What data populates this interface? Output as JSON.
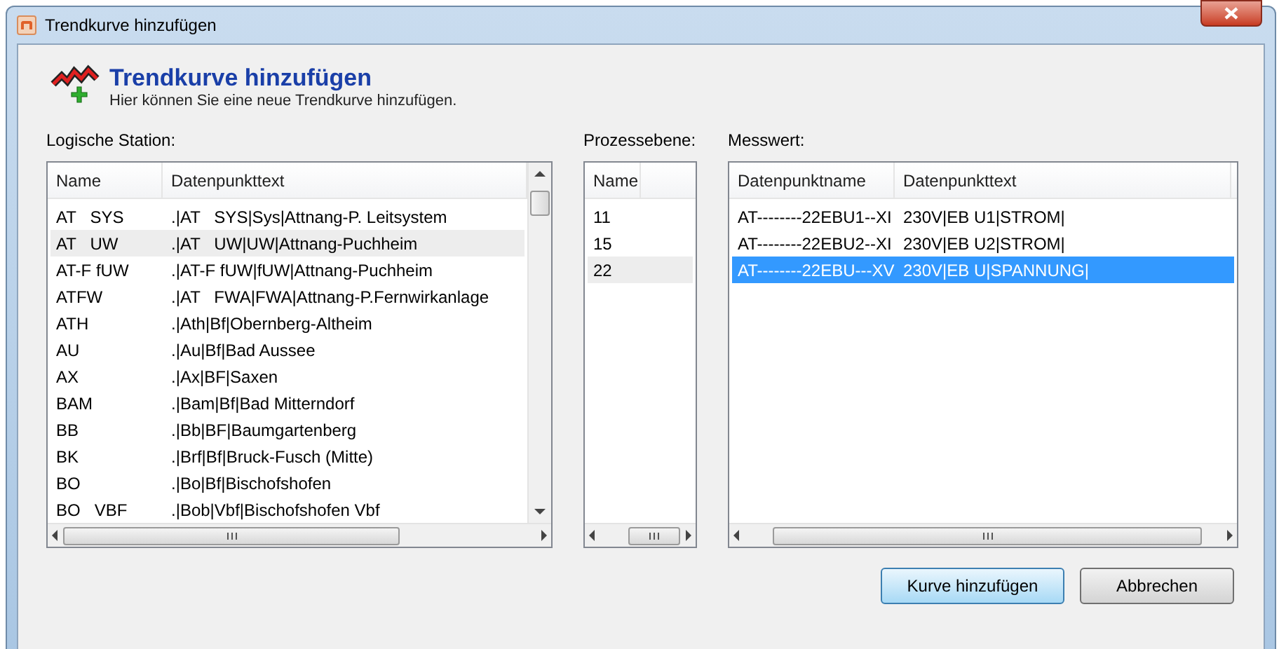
{
  "window": {
    "title": "Trendkurve hinzufügen"
  },
  "header": {
    "title": "Trendkurve hinzufügen",
    "subtitle": "Hier können Sie eine neue Trendkurve hinzufügen."
  },
  "station": {
    "label": "Logische Station:",
    "columns": [
      "Name",
      "Datenpunkttext"
    ],
    "rows": [
      {
        "cells": [
          "AT   SYS",
          ".|AT   SYS|Sys|Attnang-P. Leitsystem"
        ],
        "selected": false
      },
      {
        "cells": [
          "AT   UW",
          ".|AT   UW|UW|Attnang-Puchheim"
        ],
        "selected": true
      },
      {
        "cells": [
          "AT-F fUW",
          ".|AT-F fUW|fUW|Attnang-Puchheim"
        ],
        "selected": false
      },
      {
        "cells": [
          "ATFW",
          ".|AT   FWA|FWA|Attnang-P.Fernwirkanlage"
        ],
        "selected": false
      },
      {
        "cells": [
          "ATH",
          ".|Ath|Bf|Obernberg-Altheim"
        ],
        "selected": false
      },
      {
        "cells": [
          "AU",
          ".|Au|Bf|Bad Aussee"
        ],
        "selected": false
      },
      {
        "cells": [
          "AX",
          ".|Ax|BF|Saxen"
        ],
        "selected": false
      },
      {
        "cells": [
          "BAM",
          ".|Bam|Bf|Bad Mitterndorf"
        ],
        "selected": false
      },
      {
        "cells": [
          "BB",
          ".|Bb|BF|Baumgartenberg"
        ],
        "selected": false
      },
      {
        "cells": [
          "BK",
          ".|Brf|Bf|Bruck-Fusch (Mitte)"
        ],
        "selected": false
      },
      {
        "cells": [
          "BO",
          ".|Bo|Bf|Bischofshofen"
        ],
        "selected": false
      },
      {
        "cells": [
          "BO   VBF",
          ".|Bob|Vbf|Bischofshofen Vbf"
        ],
        "selected": false
      }
    ]
  },
  "process": {
    "label": "Prozessebene:",
    "columns": [
      "Name"
    ],
    "rows": [
      {
        "cells": [
          "11"
        ],
        "selected": false
      },
      {
        "cells": [
          "15"
        ],
        "selected": false
      },
      {
        "cells": [
          "22"
        ],
        "selected": true
      }
    ]
  },
  "measure": {
    "label": "Messwert:",
    "columns": [
      "Datenpunktname",
      "Datenpunkttext"
    ],
    "rows": [
      {
        "cells": [
          "AT--------22EBU1--XI",
          "230V|EB U1|STROM|"
        ],
        "selected": false
      },
      {
        "cells": [
          "AT--------22EBU2--XI",
          "230V|EB U2|STROM|"
        ],
        "selected": false
      },
      {
        "cells": [
          "AT--------22EBU---XV",
          "230V|EB U|SPANNUNG|"
        ],
        "selected": true
      }
    ]
  },
  "buttons": [
    {
      "label": "Kurve hinzufügen",
      "kind": "default"
    },
    {
      "label": "Abbrechen",
      "kind": "normal"
    }
  ]
}
